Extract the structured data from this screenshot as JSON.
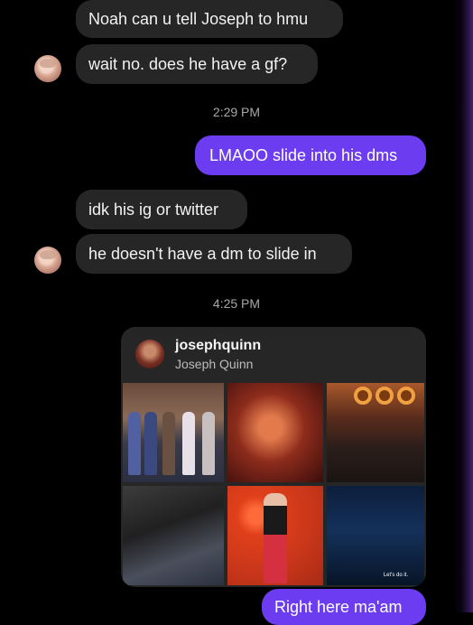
{
  "messages": [
    {
      "text": "Noah can u tell Joseph to hmu"
    },
    {
      "text": "wait no. does he have a gf?"
    },
    {
      "text": "LMAOO slide into his dms"
    },
    {
      "text": "idk his ig or twitter"
    },
    {
      "text": "he doesn't have a dm to slide in"
    },
    {
      "text": "Right here ma'am"
    }
  ],
  "timestamps": [
    "2:29 PM",
    "4:25 PM"
  ],
  "profile_card": {
    "username": "josephquinn",
    "display_name": "Joseph Quinn",
    "tile6_caption": "Let's do it."
  },
  "colors": {
    "outgoing_bubble": "#6c3df0",
    "incoming_bubble": "#262626",
    "background": "#000000"
  }
}
